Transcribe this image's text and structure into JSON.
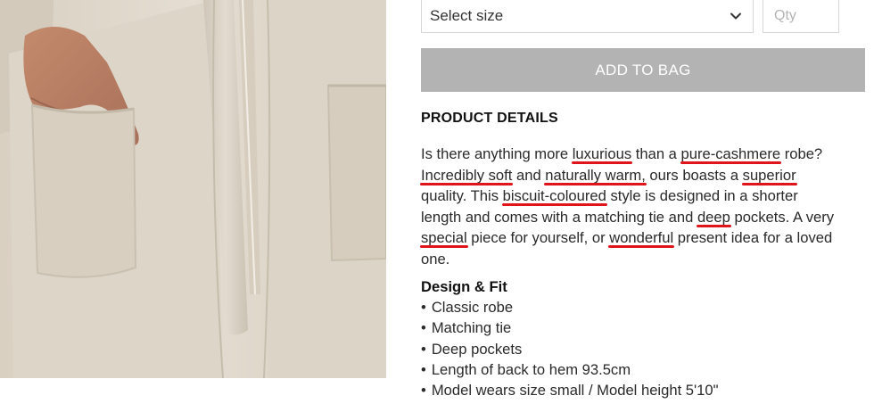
{
  "product": {
    "image_alt": "Beige cashmere robe with hand in pocket"
  },
  "purchase": {
    "size_select_label": "Select size",
    "qty_placeholder": "Qty",
    "add_to_bag_label": "ADD TO BAG",
    "add_to_bag_color": "#b3b3b3"
  },
  "details": {
    "heading": "PRODUCT DETAILS",
    "lines": [
      [
        {
          "t": "Is there anything more "
        },
        {
          "t": "luxurious",
          "hl": true
        },
        {
          "t": " than a "
        },
        {
          "t": "pure-cashmere",
          "hl": true
        },
        {
          "t": " robe?"
        }
      ],
      [
        {
          "t": "Incredibly soft",
          "hl": true
        },
        {
          "t": " and "
        },
        {
          "t": "naturally warm,",
          "hl": true
        },
        {
          "t": " ours boasts a "
        },
        {
          "t": "superior",
          "hl": true
        }
      ],
      [
        {
          "t": "quality. This "
        },
        {
          "t": "biscuit-coloured",
          "hl": true
        },
        {
          "t": " style is designed in a shorter"
        }
      ],
      [
        {
          "t": "length and comes with a matching tie and "
        },
        {
          "t": "deep",
          "hl": true
        },
        {
          "t": " pockets. A very"
        }
      ],
      [
        {
          "t": "special",
          "hl": true
        },
        {
          "t": " piece for yourself, or "
        },
        {
          "t": "wonderful",
          "hl": true
        },
        {
          "t": " present idea for a loved"
        }
      ],
      [
        {
          "t": "one."
        }
      ]
    ],
    "highlight_color": "#e0141b"
  },
  "design_fit": {
    "heading": "Design & Fit",
    "items": [
      "Classic robe",
      "Matching tie",
      "Deep pockets",
      "Length of back to hem 93.5cm",
      "Model wears size small / Model height 5'10\""
    ]
  },
  "icons": {
    "size_dropdown": "chevron-down-icon"
  }
}
